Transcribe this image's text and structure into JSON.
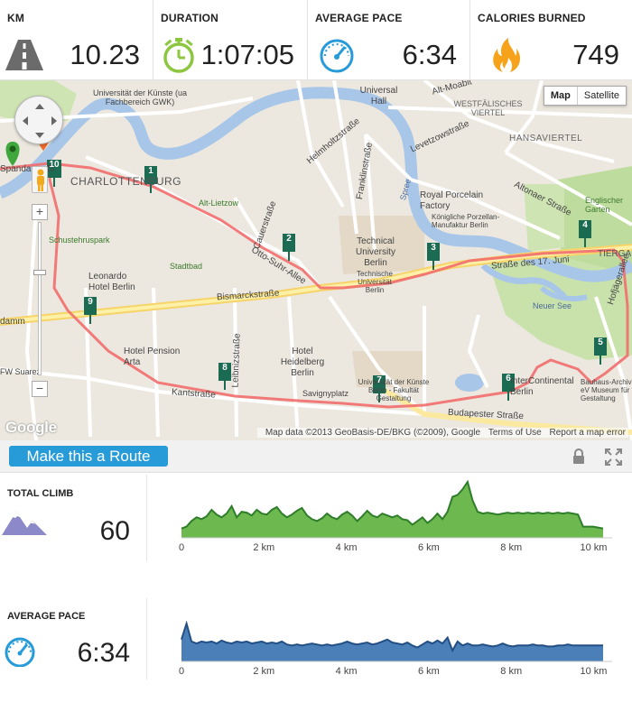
{
  "stats": [
    {
      "label": "KM",
      "value": "10.23",
      "icon": "road-icon"
    },
    {
      "label": "DURATION",
      "value": "1:07:05",
      "icon": "stopwatch-icon"
    },
    {
      "label": "AVERAGE PACE",
      "value": "6:34",
      "icon": "speedometer-icon"
    },
    {
      "label": "CALORIES BURNED",
      "value": "749",
      "icon": "flame-icon"
    }
  ],
  "colors": {
    "accent": "#279bd8",
    "green": "#8dc63f",
    "route": "#f05a5a",
    "climb_fill": "#6db950",
    "climb_line": "#2f7d2a",
    "pace_fill": "#4a7fb8",
    "pace_line": "#234f84",
    "mountain": "#8b89c7"
  },
  "map": {
    "type_buttons": [
      "Map",
      "Satellite"
    ],
    "selected_type": "Map",
    "zoom_in": "+",
    "zoom_out": "−",
    "footer": [
      "Map data ©2013 GeoBasis-DE/BKG (©2009), Google",
      "Terms of Use",
      "Report a map error"
    ],
    "logo": "Google",
    "place_labels": [
      "Universität der Künste (ua Fachbereich GWK)",
      "CHARLOTTENBURG",
      "Alt-Lietzow",
      "Schustehrus­park",
      "Stadtbad",
      "Leonardo Hotel Berlin",
      "Hotel Pension Arta",
      "Hotel Heidelberg Berlin",
      "Savignyplatz",
      "Technical University Berlin",
      "Technische Universität Berlin",
      "Universität der Künste Berlin - Fakultät Gestaltung",
      "Universal Hall",
      "WESTFÄLISCHES VIERTEL",
      "HANSAVIERTEL",
      "Royal Porcelain Factory",
      "Königliche Porzellan-Manufaktur Berlin",
      "Englischer Garten",
      "Neuer See",
      "InterContinental Berlin",
      "Bauhaus-Archiv eV Museum für Gestaltung",
      "TIERGARTEN",
      "Straße des 17. Juni",
      "Bismarckstraße",
      "Kantstraße",
      "Budapester Straße",
      "Otto-Suhr-Allee",
      "Leibnizstraße",
      "Cauerstraße",
      "Franklinstraße",
      "Helmholtzstraße",
      "Levetzowstraße",
      "Altonaer Straße",
      "Hofjägerallee",
      "Spree",
      "Alt-Moabit",
      "FW Suarez",
      "damm",
      "Spandauer Damm"
    ],
    "km_markers": [
      "1",
      "2",
      "3",
      "4",
      "5",
      "6",
      "7",
      "8",
      "9",
      "10"
    ],
    "km_unit": "km"
  },
  "toolbar": {
    "route_button": "Make this a Route"
  },
  "climb": {
    "label": "TOTAL CLIMB",
    "value": "60",
    "axis": [
      "0",
      "2 km",
      "4 km",
      "6 km",
      "8 km",
      "10 km"
    ],
    "profile": [
      10,
      12,
      18,
      22,
      20,
      23,
      30,
      25,
      22,
      26,
      34,
      22,
      28,
      27,
      24,
      30,
      26,
      25,
      30,
      33,
      26,
      22,
      25,
      29,
      32,
      24,
      20,
      18,
      21,
      26,
      22,
      20,
      25,
      28,
      24,
      18,
      23,
      29,
      24,
      22,
      26,
      24,
      22,
      24,
      20,
      19,
      14,
      18,
      22,
      16,
      20,
      26,
      20,
      28,
      44,
      46,
      52,
      60,
      40,
      28,
      26,
      27,
      26,
      25,
      26,
      27,
      26,
      27,
      26,
      27,
      26,
      27,
      26,
      27,
      26,
      27,
      26,
      27,
      26,
      25,
      12,
      12,
      12,
      11,
      10
    ]
  },
  "pace": {
    "label": "AVERAGE PACE",
    "value": "6:34",
    "axis": [
      "0",
      "2 km",
      "4 km",
      "6 km",
      "8 km",
      "10 km"
    ],
    "profile": [
      22,
      38,
      20,
      18,
      20,
      19,
      20,
      18,
      21,
      19,
      18,
      20,
      19,
      20,
      18,
      19,
      20,
      18,
      19,
      18,
      20,
      17,
      16,
      17,
      16,
      17,
      18,
      17,
      16,
      17,
      16,
      17,
      18,
      20,
      18,
      17,
      18,
      19,
      17,
      18,
      20,
      22,
      19,
      18,
      17,
      19,
      16,
      14,
      17,
      20,
      18,
      21,
      18,
      24,
      11,
      20,
      16,
      18,
      16,
      16,
      17,
      16,
      15,
      16,
      18,
      16,
      15,
      16,
      16,
      16,
      17,
      16,
      16,
      15,
      15,
      16,
      16,
      17,
      16,
      16,
      16,
      16,
      16,
      16,
      16
    ]
  }
}
